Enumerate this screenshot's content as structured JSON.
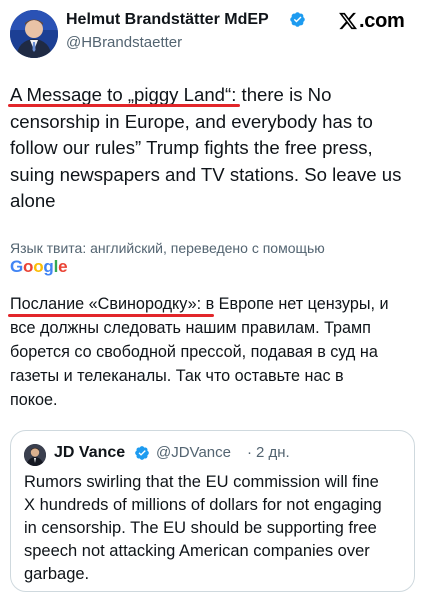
{
  "header": {
    "display_name": "Helmut Brandstätter MdEP",
    "handle": "@HBrandstaetter",
    "brand": ".com",
    "avatar_icon": "user-avatar",
    "verified_icon": "verified-badge-icon",
    "brand_icon": "x-logo-icon"
  },
  "tweet": {
    "lines": [
      "A Message to „piggy Land“: there is No",
      "censorship in Europe, and everybody has to",
      "follow our rules” Trump fights the free press,",
      "suing newspapers and TV stations. So leave us",
      "alone"
    ]
  },
  "translation": {
    "note": "Язык твита: английский, переведено с помощью",
    "provider": "Google",
    "lines": [
      "Послание «Свинородку»: в Европе нет цензуры, и",
      "все должны следовать нашим правилам. Трамп",
      "борется со свободной прессой, подавая в суд на",
      "газеты и телеканалы. Так что оставьте нас в",
      "покое."
    ]
  },
  "quote": {
    "name": "JD Vance",
    "handle": "@JDVance",
    "separator": "·",
    "time": "2 дн.",
    "lines": [
      "Rumors swirling that the EU commission will fine",
      "X hundreds of millions of dollars for not engaging",
      "in censorship. The EU should be supporting free",
      "speech not attacking American companies over",
      "garbage."
    ]
  },
  "colors": {
    "underline": "#e2262a",
    "verified": "#1d9bf0",
    "secondary_text": "#536471"
  }
}
